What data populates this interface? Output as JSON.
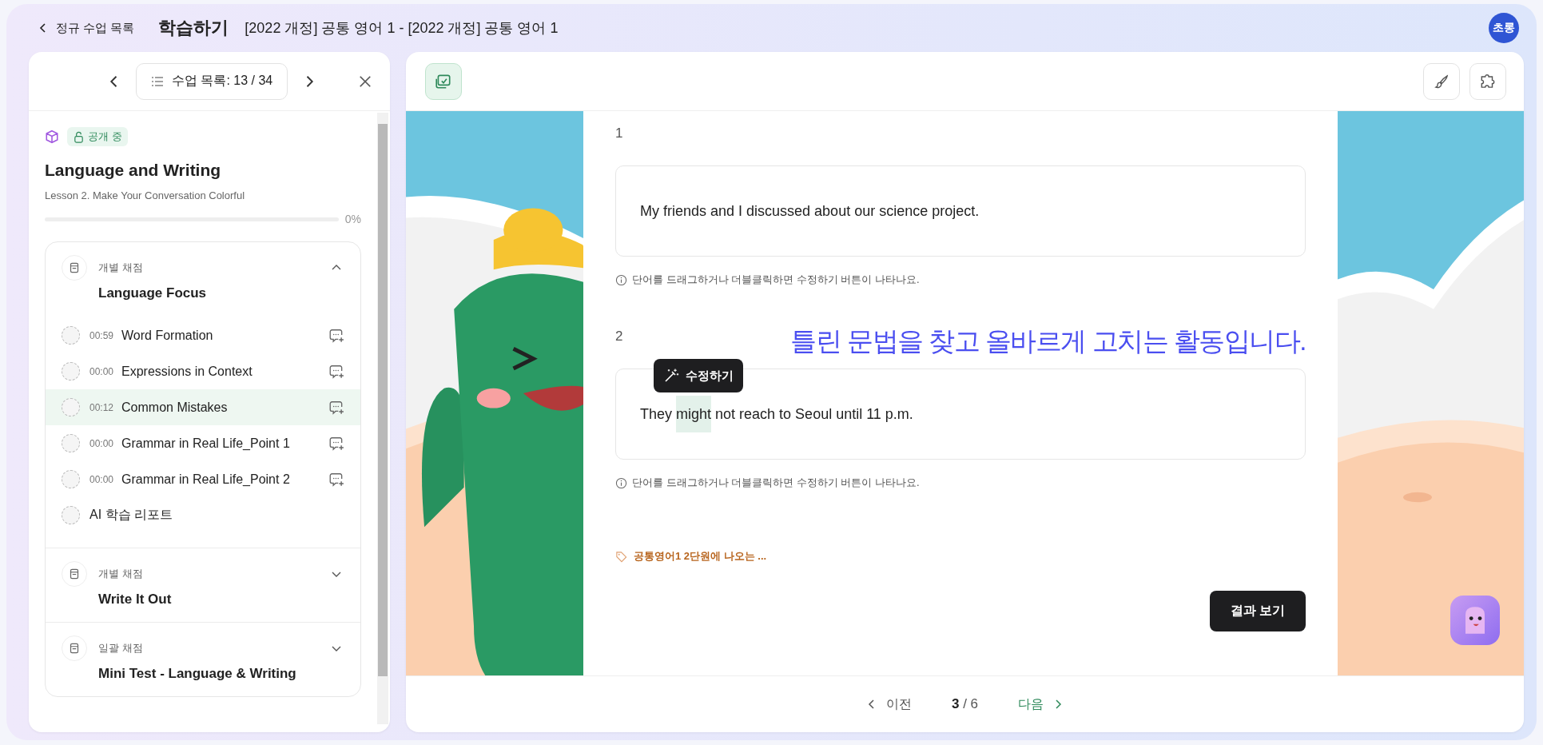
{
  "top_bar": {
    "back_link": "정규 수업 목록",
    "title": "학습하기",
    "subtitle": "[2022 개정] 공통 영어 1 - [2022 개정] 공통 영어 1",
    "avatar": "초롱"
  },
  "sidebar": {
    "list_button": "수업 목록: 13 / 34",
    "status_badge": "공개 중",
    "title": "Language and Writing",
    "subtitle": "Lesson 2. Make Your Conversation Colorful",
    "progress": {
      "level": 0,
      "reading": "0%"
    },
    "sections": [
      {
        "grading": "개별 채점",
        "title": "Language Focus",
        "expanded": true,
        "items": [
          {
            "kind": "lesson",
            "time": "00:59",
            "label": "Word Formation",
            "selected": false
          },
          {
            "kind": "lesson",
            "time": "00:00",
            "label": "Expressions in Context",
            "selected": false
          },
          {
            "kind": "lesson",
            "time": "00:12",
            "label": "Common Mistakes",
            "selected": true
          },
          {
            "kind": "lesson",
            "time": "00:00",
            "label": "Grammar in Real Life_Point 1",
            "selected": false
          },
          {
            "kind": "lesson",
            "time": "00:00",
            "label": "Grammar in Real Life_Point 2",
            "selected": false
          },
          {
            "kind": "report",
            "label": "AI 학습 리포트",
            "selected": false
          }
        ]
      },
      {
        "grading": "개별 채점",
        "title": "Write It Out",
        "expanded": false
      },
      {
        "grading": "일괄 채점",
        "title": "Mini Test - Language & Writing",
        "expanded": false
      }
    ]
  },
  "activity": {
    "questions": [
      {
        "number": "1",
        "segments": [
          {
            "text": "My friends and I discussed about our science project.",
            "selected": false
          }
        ],
        "hint": "단어를 드래그하거나 더블클릭하면 수정하기 버튼이 나타나요."
      },
      {
        "number": "2",
        "caption": "틀린 문법을 찾고 올바르게 고치는 활동입니다.",
        "edit_button": "수정하기",
        "segments": [
          {
            "text": "They ",
            "selected": false
          },
          {
            "text": "might",
            "selected": true
          },
          {
            "text": " not reach to Seoul until 11 p.m.",
            "selected": false
          }
        ],
        "hint": "단어를 드래그하거나 더블클릭하면 수정하기 버튼이 나타나요."
      }
    ],
    "tag": "공통영어1 2단원에 나오는 ...",
    "result_button": "결과 보기"
  },
  "pager": {
    "prev": "이전",
    "current": "3",
    "total": "/ 6",
    "next": "다음"
  }
}
